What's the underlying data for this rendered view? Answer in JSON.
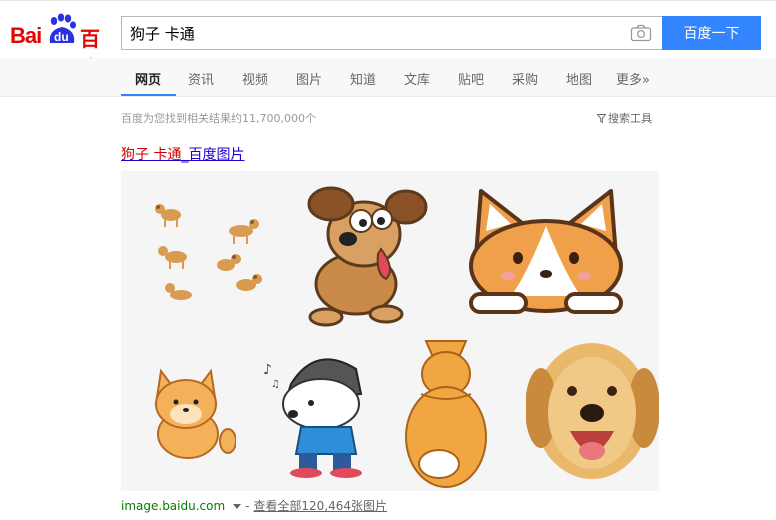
{
  "logo": {
    "part1": "Bai",
    "part2": "du",
    "part3": "百度"
  },
  "search": {
    "query": "狗子 卡通",
    "button_label": "百度一下"
  },
  "nav": {
    "items": [
      "网页",
      "资讯",
      "视频",
      "图片",
      "知道",
      "文库",
      "贴吧",
      "采购",
      "地图",
      "更多»"
    ],
    "active": "网页"
  },
  "results": {
    "count_text": "百度为您找到相关结果约11,700,000个",
    "tools_label": "搜索工具",
    "title_highlight": "狗子 卡通",
    "title_rest": "_百度图片",
    "source_domain": "image.baidu.com",
    "source_sep": "-",
    "source_more": "查看全部120,464张图片"
  },
  "colors": {
    "brand_red": "#e10601",
    "accent_blue": "#3385ff",
    "link": "#2000cc",
    "highlight": "#cc0000",
    "source_green": "#008000"
  }
}
